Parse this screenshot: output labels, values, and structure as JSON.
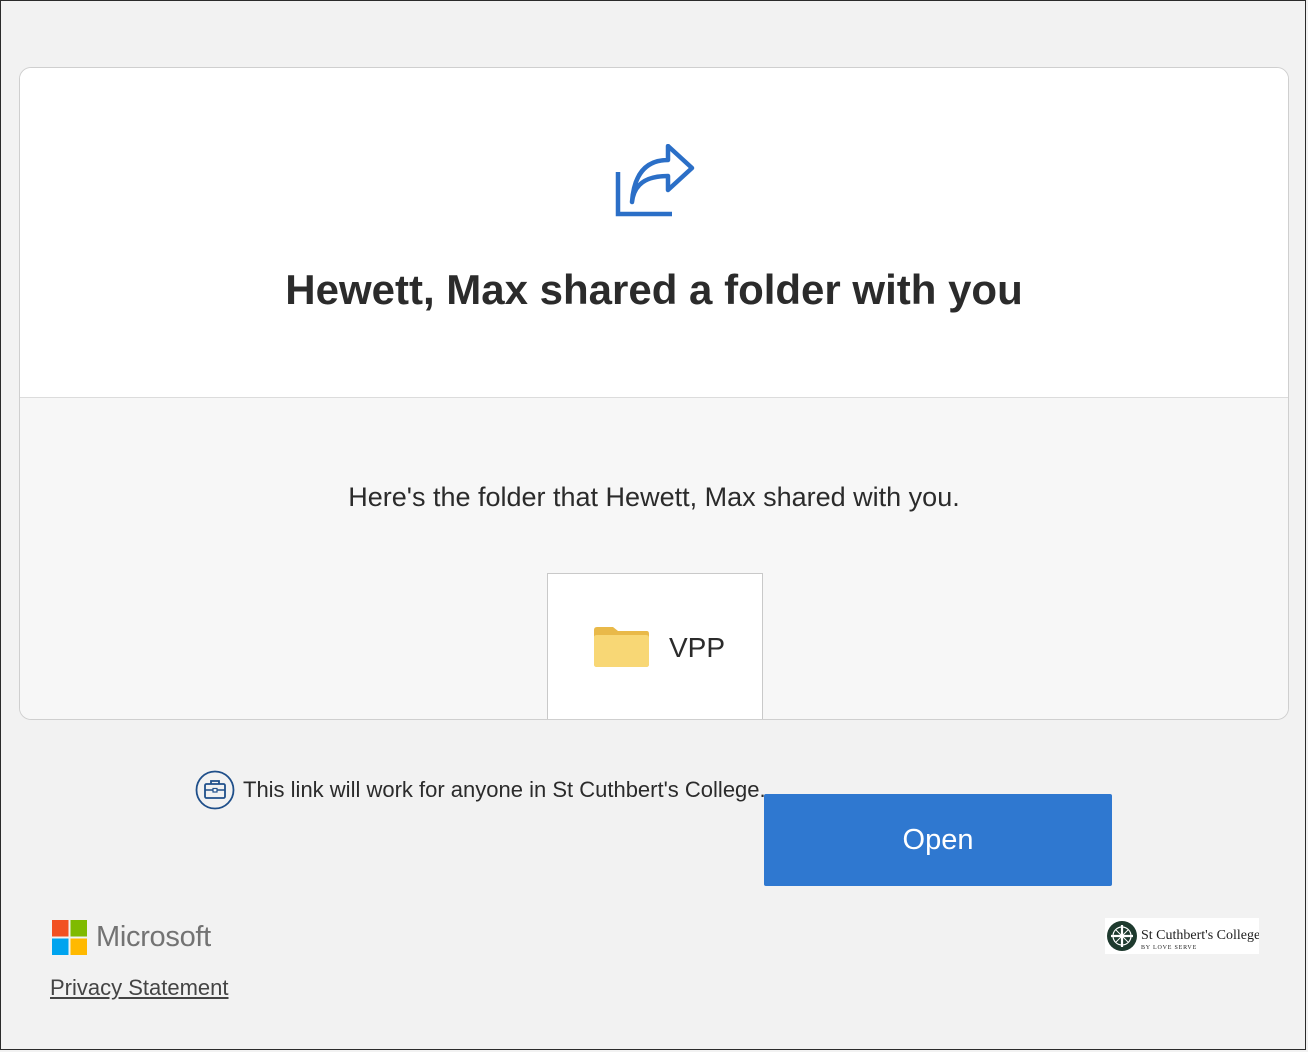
{
  "header": {
    "title": "Hewett, Max shared a folder with you"
  },
  "body": {
    "message": "Here's the folder that Hewett, Max shared with you.",
    "folder": {
      "name": "VPP",
      "icon": "folder-icon"
    }
  },
  "link_note": {
    "text": "This link will work for anyone in St Cuthbert's College.",
    "icon": "briefcase-icon"
  },
  "actions": {
    "open_label": "Open"
  },
  "footer": {
    "brand": "Microsoft",
    "privacy_label": "Privacy Statement",
    "college_logo": {
      "name": "St Cuthbert's College",
      "motto": "BY LOVE SERVE"
    }
  },
  "colors": {
    "accent": "#2f78d0",
    "icon_blue": "#2b6fc7",
    "folder_yellow": "#f8d775"
  }
}
